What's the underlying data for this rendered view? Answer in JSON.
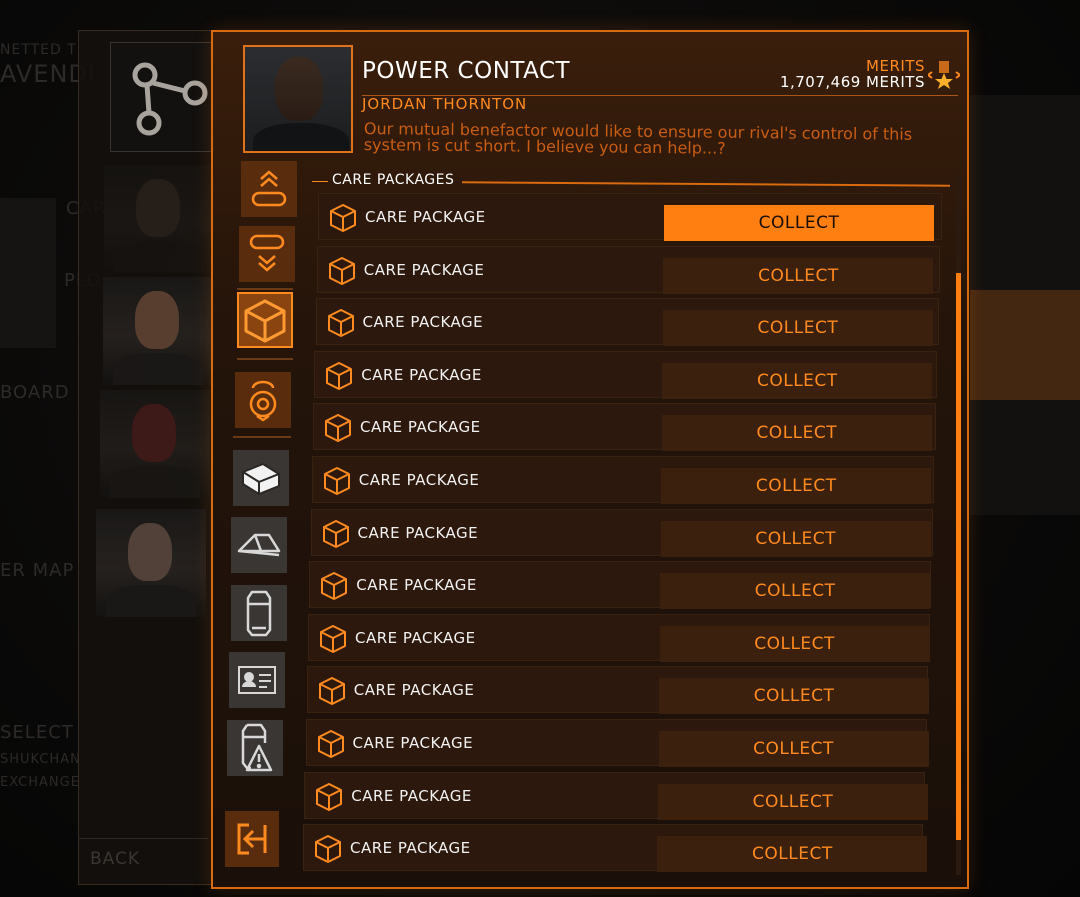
{
  "background": {
    "left_texts": [
      "NETTED T",
      "AVENDI",
      "CAR",
      "PLO",
      "BOARD",
      "ER MAP",
      "SELECT",
      "SHUKCHAN",
      "EXCHANGE"
    ],
    "back_label": "BACK"
  },
  "contact": {
    "title": "POWER CONTACT",
    "name": "JORDAN THORNTON",
    "message": "Our mutual benefactor would like to ensure our rival's control of this system is cut short. I believe you can help...?",
    "merits_label": "MERITS",
    "merits_value": "1,707,469 MERITS"
  },
  "section": {
    "title": "CARE PACKAGES"
  },
  "rows": [
    {
      "label": "CARE PACKAGE",
      "button": "COLLECT",
      "selected": true
    },
    {
      "label": "CARE PACKAGE",
      "button": "COLLECT",
      "selected": false
    },
    {
      "label": "CARE PACKAGE",
      "button": "COLLECT",
      "selected": false
    },
    {
      "label": "CARE PACKAGE",
      "button": "COLLECT",
      "selected": false
    },
    {
      "label": "CARE PACKAGE",
      "button": "COLLECT",
      "selected": false
    },
    {
      "label": "CARE PACKAGE",
      "button": "COLLECT",
      "selected": false
    },
    {
      "label": "CARE PACKAGE",
      "button": "COLLECT",
      "selected": false
    },
    {
      "label": "CARE PACKAGE",
      "button": "COLLECT",
      "selected": false
    },
    {
      "label": "CARE PACKAGE",
      "button": "COLLECT",
      "selected": false
    },
    {
      "label": "CARE PACKAGE",
      "button": "COLLECT",
      "selected": false
    },
    {
      "label": "CARE PACKAGE",
      "button": "COLLECT",
      "selected": false
    },
    {
      "label": "CARE PACKAGE",
      "button": "COLLECT",
      "selected": false
    },
    {
      "label": "CARE PACKAGE",
      "button": "COLLECT",
      "selected": false
    }
  ],
  "tabs": [
    {
      "icon": "cargo-up-icon",
      "style": "orange"
    },
    {
      "icon": "cargo-down-icon",
      "style": "orange"
    },
    {
      "icon": "care-package-icon",
      "style": "active"
    },
    {
      "icon": "agent-icon",
      "style": "orange"
    },
    {
      "icon": "supply-crate-icon",
      "style": "gray"
    },
    {
      "icon": "wedge-cargo-icon",
      "style": "gray"
    },
    {
      "icon": "canister-icon",
      "style": "gray"
    },
    {
      "icon": "id-card-icon",
      "style": "gray"
    },
    {
      "icon": "hazard-canister-icon",
      "style": "gray"
    }
  ],
  "scroll": {
    "position_fraction": 0.14,
    "visible_fraction": 0.81
  },
  "colors": {
    "accent": "#ff8a1f",
    "selected_button": "#ff7f11",
    "panel": "#24140a"
  }
}
